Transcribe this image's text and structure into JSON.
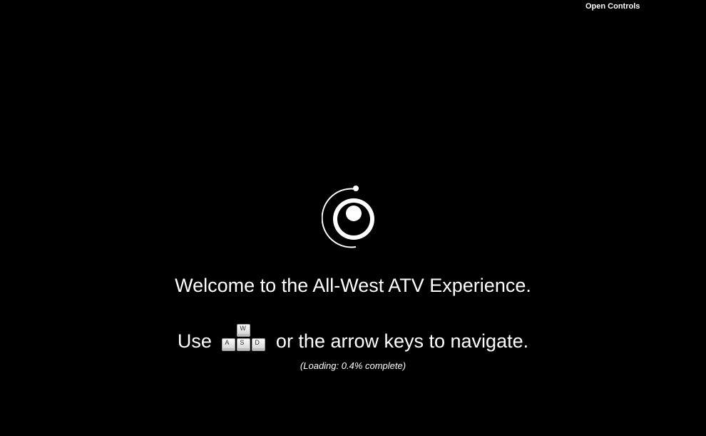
{
  "controls": {
    "open_label": "Open Controls"
  },
  "logo": {
    "icon": "eye-orbit-logo-icon",
    "color": "#ffffff"
  },
  "welcome": {
    "text": "Welcome to the All-West ATV Experience."
  },
  "navigation": {
    "prefix": "Use",
    "keys": [
      "W",
      "A",
      "S",
      "D"
    ],
    "suffix": "or the arrow keys to navigate."
  },
  "loading": {
    "text": "(Loading: 0.4% complete)",
    "progress_percent": 0.4
  },
  "colors": {
    "background": "#000000",
    "text": "#ffffff"
  }
}
